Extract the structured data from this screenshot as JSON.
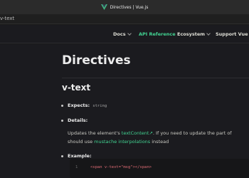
{
  "window": {
    "title": "Directives | Vue.js"
  },
  "urlbar": {
    "crumb": "v-text"
  },
  "nav": {
    "items": [
      {
        "label": "Docs"
      },
      {
        "label": "API Reference"
      },
      {
        "label": "Ecosystem"
      },
      {
        "label": "Support Vue"
      }
    ]
  },
  "page": {
    "title": "Directives",
    "section": "v-text",
    "expects_label": "Expects:",
    "expects_value": "string",
    "details_label": "Details:",
    "details_line1_pre": "Updates the element's ",
    "details_line1_link": "textContent",
    "details_line1_post": ". If you need to update the part of",
    "details_line2_pre": "should use ",
    "details_line2_link": "mustache interpolations",
    "details_line2_post": " instead",
    "example_label": "Example:"
  },
  "code": {
    "line_number": "1",
    "source": "<span v-text=\"msg\"></span>"
  },
  "colors": {
    "accent": "#42d392",
    "background": "#1b1b1f"
  }
}
